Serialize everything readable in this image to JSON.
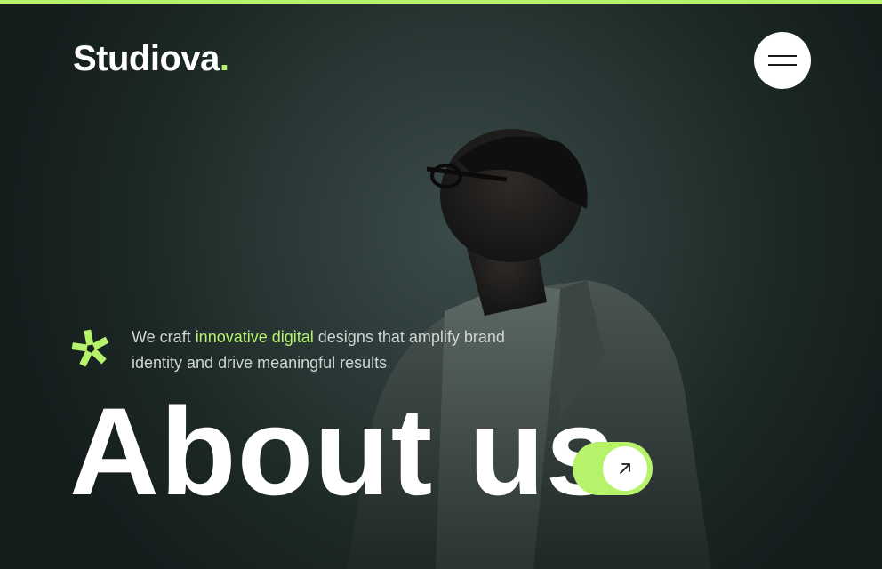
{
  "brand": {
    "name": "Studiova",
    "dot": ".",
    "accent_color": "#b6f36b"
  },
  "header": {
    "menu_icon": "hamburger-menu-icon"
  },
  "hero": {
    "badge_icon": "asterisk-icon",
    "tagline_before": "We craft ",
    "tagline_highlight": "innovative digital",
    "tagline_after": " designs that amplify brand identity and drive meaningful results",
    "headline": "About us",
    "cta_icon": "arrow-up-right-icon"
  },
  "colors": {
    "background": "#1c2826",
    "accent": "#b6f36b",
    "text": "#ffffff"
  }
}
